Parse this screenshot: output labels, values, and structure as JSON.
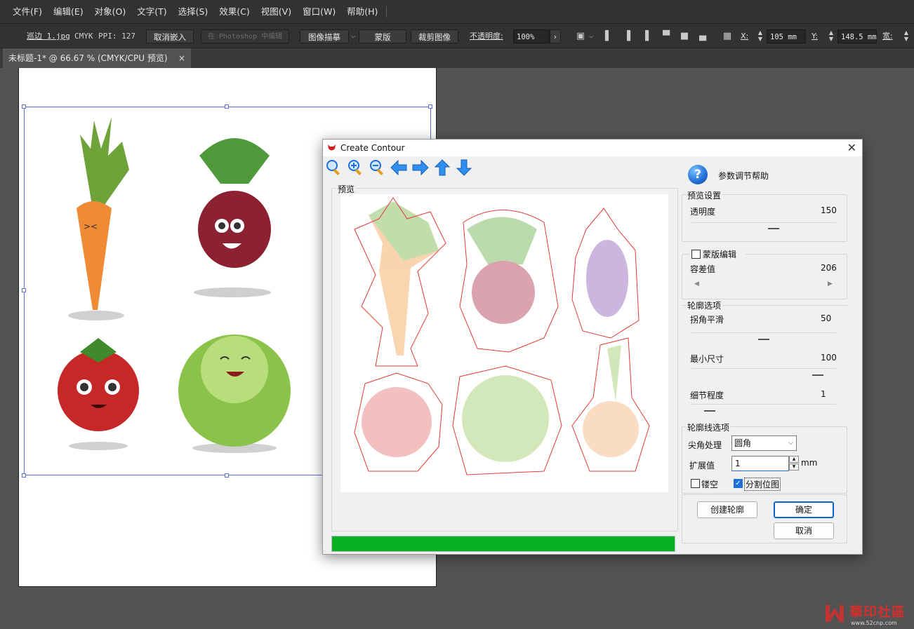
{
  "menu": [
    "文件(F)",
    "编辑(E)",
    "对象(O)",
    "文字(T)",
    "选择(S)",
    "效果(C)",
    "视图(V)",
    "窗口(W)",
    "帮助(H)"
  ],
  "control_bar": {
    "file_name": "巡边 1.jpg",
    "color_mode": "CMYK",
    "ppi": "PPI: 127",
    "unembed": "取消嵌入",
    "edit_in_photoshop": "在 Photoshop 中编辑",
    "image_trace": "图像描摹",
    "mask": "蒙版",
    "crop_image": "裁剪图像",
    "opacity_label": "不透明度:",
    "opacity_value": "100%",
    "x_label": "X:",
    "x_value": "105 mm",
    "y_label": "Y:",
    "y_value": "148.5 mm",
    "width_label": "宽:"
  },
  "document_tab": {
    "title": "未标题-1* @ 66.67 % (CMYK/CPU 预览)",
    "close": "×"
  },
  "dialog": {
    "title": "Create Contour",
    "preview_label": "预览",
    "progress": 1.0,
    "help_label": "参数调节帮助",
    "preview_settings": {
      "header": "预览设置",
      "transparency_label": "透明度",
      "transparency_value": "150"
    },
    "mask_edit": {
      "label": "蒙版编辑",
      "checked": false,
      "tolerance_label": "容差值",
      "tolerance_value": "206"
    },
    "contour_options": {
      "header": "轮廓选项",
      "corner_smooth_label": "拐角平滑",
      "corner_smooth_value": "50",
      "min_size_label": "最小尺寸",
      "min_size_value": "100",
      "detail_label": "细节程度",
      "detail_value": "1"
    },
    "contour_line_options": {
      "header": "轮廓线选项",
      "corner_label": "尖角处理",
      "corner_value": "圆角",
      "expand_label": "扩展值",
      "expand_value": "1",
      "expand_unit": "mm",
      "hollow_label": "镂空",
      "hollow_checked": false,
      "split_label": "分割位图",
      "split_checked": true
    },
    "buttons": {
      "create": "创建轮廓",
      "ok": "确定",
      "cancel": "取消"
    }
  },
  "watermark": {
    "text": "華印社區",
    "url": "www.52cnp.com"
  },
  "colors": {
    "accent": "#1f6fd6",
    "progress": "#06b025",
    "selection": "#5a6fd8",
    "contour": "#e53935"
  }
}
